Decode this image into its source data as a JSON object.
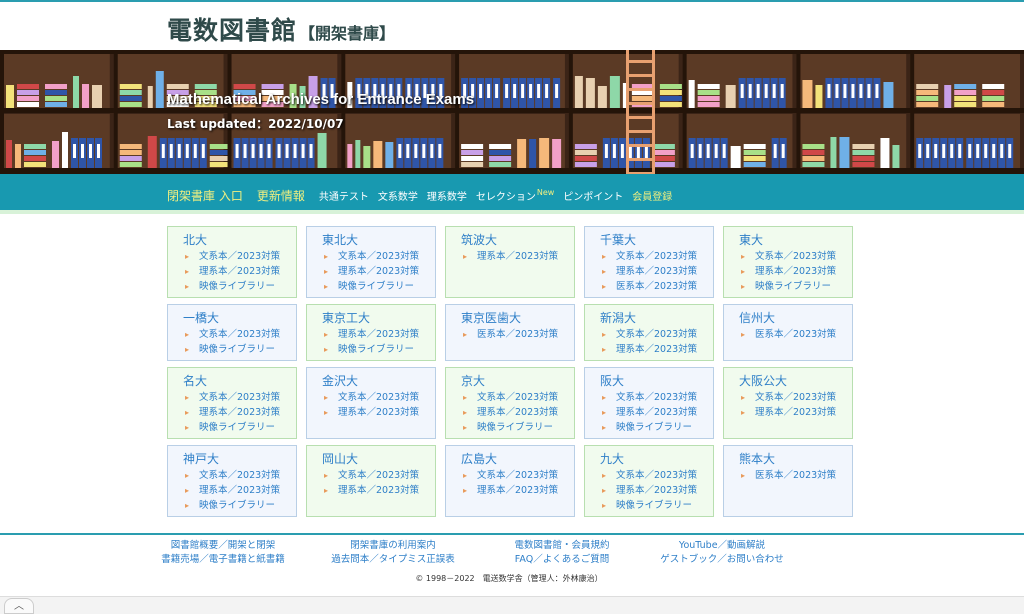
{
  "header": {
    "title": "電数図書館",
    "subtitle": "【開架書庫】"
  },
  "banner": {
    "title": "Mathematical Archives for Entrance Exams",
    "updated": "Last updated：2022/10/07"
  },
  "nav": {
    "items": [
      {
        "label": "閉架書庫 入口",
        "style": "big"
      },
      {
        "label": "更新情報",
        "style": "big"
      },
      {
        "label": "共通テスト",
        "style": "normal"
      },
      {
        "label": "文系数学",
        "style": "normal"
      },
      {
        "label": "理系数学",
        "style": "normal"
      },
      {
        "label": "セレクション",
        "style": "normal",
        "badge": "New"
      },
      {
        "label": "ピンポイント",
        "style": "normal"
      },
      {
        "label": "会員登録",
        "style": "yellow"
      }
    ]
  },
  "universities": [
    {
      "name": "北大",
      "links": [
        "文系本／2023対策",
        "理系本／2023対策",
        "映像ライブラリー"
      ]
    },
    {
      "name": "東北大",
      "links": [
        "文系本／2023対策",
        "理系本／2023対策",
        "映像ライブラリー"
      ]
    },
    {
      "name": "筑波大",
      "links": [
        "理系本／2023対策"
      ]
    },
    {
      "name": "千葉大",
      "links": [
        "文系本／2023対策",
        "理系本／2023対策",
        "医系本／2023対策"
      ]
    },
    {
      "name": "東大",
      "links": [
        "文系本／2023対策",
        "理系本／2023対策",
        "映像ライブラリー"
      ]
    },
    {
      "name": "一橋大",
      "links": [
        "文系本／2023対策",
        "映像ライブラリー"
      ]
    },
    {
      "name": "東京工大",
      "links": [
        "理系本／2023対策",
        "映像ライブラリー"
      ]
    },
    {
      "name": "東京医歯大",
      "links": [
        "医系本／2023対策"
      ]
    },
    {
      "name": "新潟大",
      "links": [
        "文系本／2023対策",
        "理系本／2023対策"
      ]
    },
    {
      "name": "信州大",
      "links": [
        "医系本／2023対策"
      ]
    },
    {
      "name": "名大",
      "links": [
        "文系本／2023対策",
        "理系本／2023対策",
        "映像ライブラリー"
      ]
    },
    {
      "name": "金沢大",
      "links": [
        "文系本／2023対策",
        "理系本／2023対策"
      ]
    },
    {
      "name": "京大",
      "links": [
        "文系本／2023対策",
        "理系本／2023対策",
        "映像ライブラリー"
      ]
    },
    {
      "name": "阪大",
      "links": [
        "文系本／2023対策",
        "理系本／2023対策",
        "映像ライブラリー"
      ]
    },
    {
      "name": "大阪公大",
      "links": [
        "文系本／2023対策",
        "理系本／2023対策"
      ]
    },
    {
      "name": "神戸大",
      "links": [
        "文系本／2023対策",
        "理系本／2023対策",
        "映像ライブラリー"
      ]
    },
    {
      "name": "岡山大",
      "links": [
        "文系本／2023対策",
        "理系本／2023対策"
      ]
    },
    {
      "name": "広島大",
      "links": [
        "文系本／2023対策",
        "理系本／2023対策"
      ]
    },
    {
      "name": "九大",
      "links": [
        "文系本／2023対策",
        "理系本／2023対策",
        "映像ライブラリー"
      ]
    },
    {
      "name": "熊本大",
      "links": [
        "医系本／2023対策"
      ]
    }
  ],
  "footer": {
    "columns": [
      [
        "図書館概要／開架と閉架",
        "書籍売場／電子書籍と紙書籍"
      ],
      [
        "閉架書庫の利用案内",
        "過去問本／タイプミス正誤表"
      ],
      [
        "電数図書館・会員規約",
        "FAQ／よくあるご質問"
      ],
      [
        "YouTube／動画解説",
        "ゲストブック／お問い合わせ"
      ]
    ],
    "copyright": "© 1998－2022　電送数学舎（管理人：外林康治）"
  },
  "browser": {
    "scroll_top_icon": "chevron-up-icon",
    "scroll_top_glyph": "︿"
  },
  "colors": {
    "accent": "#1899b0",
    "link": "#2e7fc8",
    "nav_highlight": "#f0ef80"
  }
}
